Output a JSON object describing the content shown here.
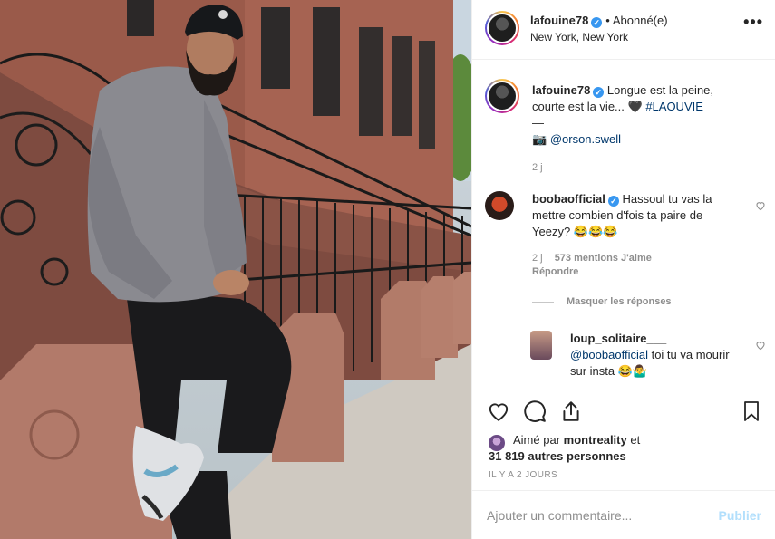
{
  "post": {
    "username": "lafouine78",
    "follow_separator": "•",
    "follow_status": "Abonné(e)",
    "location": "New York, New York",
    "more_label": "•••"
  },
  "caption": {
    "username": "lafouine78",
    "text_line1": "Longue est la peine,",
    "text_line2": "courte est la vie... 🖤",
    "hashtag": "#LAOUVIE",
    "separator": "—",
    "credit_prefix": "📷",
    "credit_user": "@orson.swell",
    "time": "2 j"
  },
  "comments": [
    {
      "username": "boobaofficial",
      "text": "Hassoul tu vas la mettre combien d'fois ta paire de Yeezy? 😂😂😂",
      "time": "2 j",
      "likes": "573 mentions J'aime",
      "reply": "Répondre"
    }
  ],
  "hide_replies": "Masquer les réponses",
  "replies": [
    {
      "username": "loup_solitaire___",
      "mention": "@boobaofficial",
      "text": "toi tu va mourir sur insta 😂🤷‍♂️"
    }
  ],
  "likes": {
    "prefix": "Aimé par",
    "user": "montreality",
    "connector": "et",
    "others": "31 819 autres personnes"
  },
  "time_ago": "IL Y A 2 JOURS",
  "add_comment": {
    "placeholder": "Ajouter un commentaire...",
    "publish": "Publier"
  },
  "icons": {
    "like": "heart-icon",
    "comment": "comment-icon",
    "share": "share-icon",
    "save": "bookmark-icon",
    "more": "more-options-icon",
    "verified": "verified-badge-icon"
  },
  "colors": {
    "link": "#00376b",
    "verified": "#3897f0",
    "muted": "#8e8e8e",
    "publish_disabled": "#b2dffc"
  }
}
